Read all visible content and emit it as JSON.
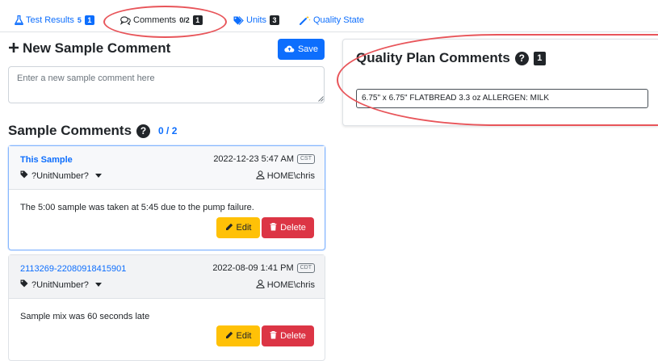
{
  "tabs": [
    {
      "label": "Test Results",
      "count": "5",
      "badge": "1",
      "icon": "flask-icon"
    },
    {
      "label": "Comments",
      "count": "0/2",
      "badge": "1",
      "icon": "comments-icon"
    },
    {
      "label": "Units",
      "badge": "3",
      "icon": "tags-icon"
    },
    {
      "label": "Quality State",
      "icon": "magic-wand-icon"
    }
  ],
  "new_comment": {
    "title": "New Sample Comment",
    "save_label": "Save",
    "placeholder": "Enter a new sample comment here",
    "value": ""
  },
  "sample_comments": {
    "title": "Sample Comments",
    "count": "0 / 2",
    "items": [
      {
        "name": "This Sample",
        "unit": "?UnitNumber?",
        "date": "2022-12-23 5:47 AM",
        "tz": "CST",
        "user": "HOME\\chris",
        "text": "The 5:00 sample was taken at 5:45 due to the pump failure.",
        "edit_label": "Edit",
        "delete_label": "Delete"
      },
      {
        "name": "2113269-22080918415901",
        "unit": "?UnitNumber?",
        "date": "2022-08-09 1:41 PM",
        "tz": "CDT",
        "user": "HOME\\chris",
        "text": "Sample mix was 60 seconds late",
        "edit_label": "Edit",
        "delete_label": "Delete"
      }
    ]
  },
  "quality_plan": {
    "title": "Quality Plan Comments",
    "badge": "1",
    "comment": "6.75\" x 6.75\" FLATBREAD 3.3 oz ALLERGEN: MILK"
  },
  "colors": {
    "primary": "#0d6efd",
    "warning": "#ffc107",
    "danger": "#dc3545",
    "annotation": "#e8555a"
  }
}
